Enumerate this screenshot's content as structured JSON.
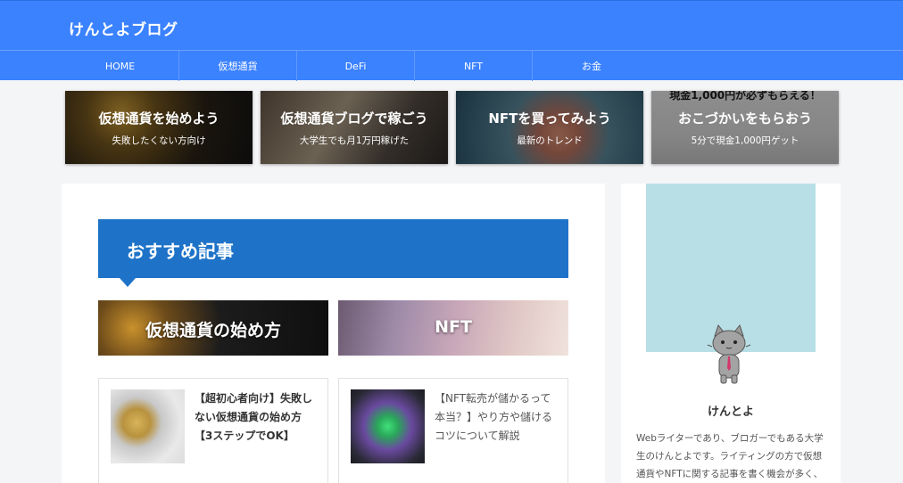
{
  "header": {
    "site_title": "けんとよブログ"
  },
  "nav": {
    "items": [
      "HOME",
      "仮想通貨",
      "DeFi",
      "NFT",
      "お金"
    ]
  },
  "pickups": [
    {
      "title": "仮想通貨を始めよう",
      "subtitle": "失敗したくない方向け"
    },
    {
      "title": "仮想通貨ブログで稼ごう",
      "subtitle": "大学生でも月1万円稼げた"
    },
    {
      "title": "NFTを買ってみよう",
      "subtitle": "最新のトレンド"
    },
    {
      "title": "おこづかいをもらおう",
      "subtitle": "5分で現金1,000円ゲット",
      "image_text": "現金1,000円が必ずもらえる！"
    }
  ],
  "main": {
    "section_heading": "おすすめ記事",
    "categories": [
      "仮想通貨の始め方",
      "NFT"
    ],
    "articles": [
      {
        "title": "【超初心者向け】失敗しない仮想通貨の始め方【3ステップでOK】"
      },
      {
        "title": "【NFT転売が儲かるって本当？】やり方や儲けるコツについて解説"
      }
    ]
  },
  "sidebar": {
    "profile_name": "けんとよ",
    "profile_desc": "Webライターであり、ブロガーでもある大学生のけんとよです。ライティングの方で仮想通貨やNFTに関する記事を書く機会が多く、"
  },
  "colors": {
    "header": "#3b82ff",
    "section_head": "#1e73c8",
    "profile_bg": "#b8dfe6"
  }
}
